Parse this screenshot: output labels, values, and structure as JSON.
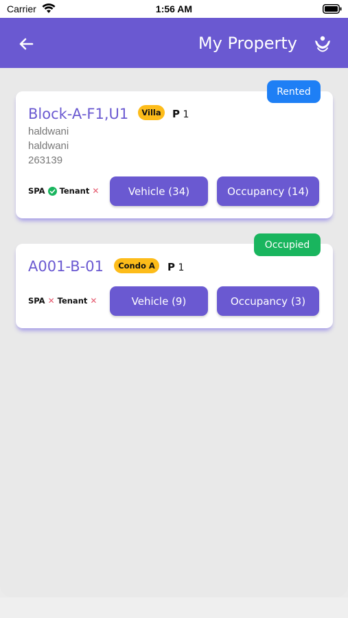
{
  "status_bar": {
    "carrier": "Carrier",
    "time": "1:56 AM"
  },
  "header": {
    "title": "My Property",
    "back_icon": "arrow-left-icon",
    "logo_icon": "hands-logo-icon"
  },
  "colors": {
    "primary": "#6a59d1",
    "rented": "#1e7ff5",
    "occupied": "#19b55e",
    "type_badge": "#fdbc1a",
    "x_red": "#e55a6f"
  },
  "properties": [
    {
      "status": "Rented",
      "unit": "Block-A-F1,U1",
      "type": "Villa",
      "parking_prefix": "P",
      "parking_count": "1",
      "address_line1": "haldwani",
      "address_line2": "haldwani",
      "pincode": "263139",
      "spa_label": "SPA",
      "tenant_label": "Tenant",
      "vehicle_btn": "Vehicle (34)",
      "occupancy_btn": "Occupancy (14)"
    },
    {
      "status": "Occupied",
      "unit": "A001-B-01",
      "type": "Condo A",
      "parking_prefix": "P",
      "parking_count": "1",
      "spa_label": "SPA",
      "tenant_label": "Tenant",
      "vehicle_btn": "Vehicle (9)",
      "occupancy_btn": "Occupancy (3)"
    }
  ]
}
